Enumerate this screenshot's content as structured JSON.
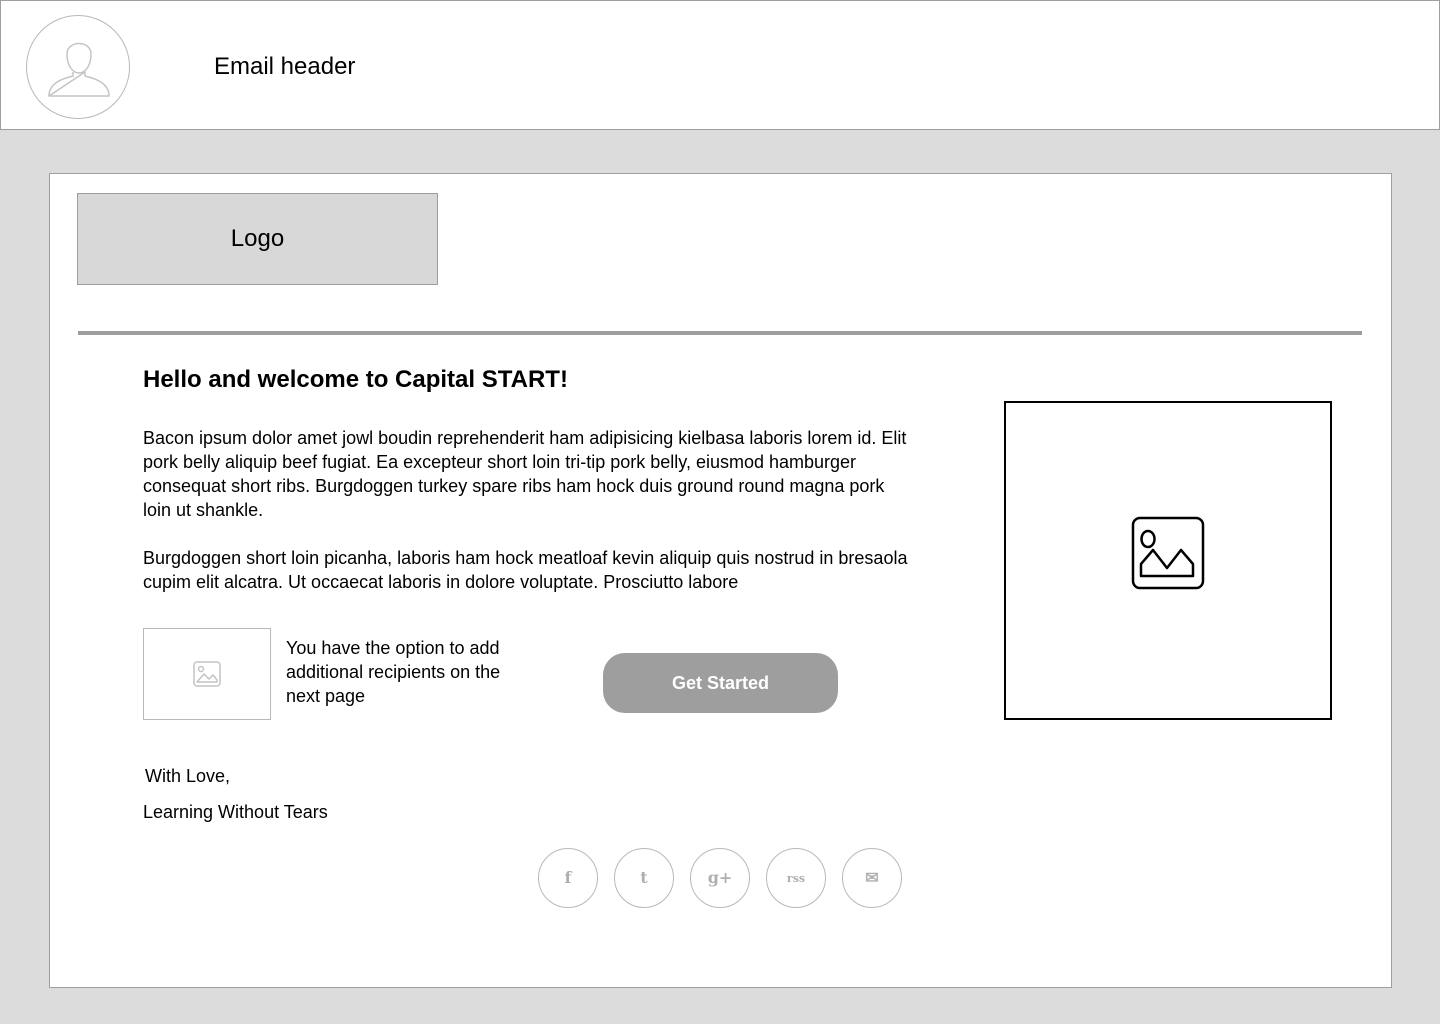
{
  "header": {
    "title": "Email header",
    "avatar_icon": "user-avatar-icon"
  },
  "email": {
    "logo_label": "Logo",
    "welcome_title": "Hello and welcome to Capital START!",
    "paragraphs": [
      "Bacon ipsum dolor amet jowl boudin reprehenderit ham adipisicing kielbasa laboris lorem id. Elit pork belly aliquip beef fugiat. Ea excepteur short loin tri-tip pork belly, eiusmod hamburger consequat short ribs. Burgdoggen turkey spare ribs ham hock duis ground round magna pork loin ut shankle.",
      "Burgdoggen short loin picanha, laboris ham hock meatloaf kevin aliquip quis nostrud in bresaola cupim elit alcatra. Ut occaecat laboris in dolore voluptate. Prosciutto labore"
    ],
    "hero_image_icon": "image-placeholder-icon",
    "thumb_image_icon": "image-placeholder-icon",
    "option_text": "You have the option to add additional recipients on the next page",
    "cta_label": "Get Started",
    "signoff": "With Love,",
    "signature": "Learning Without Tears"
  },
  "social": [
    {
      "name": "facebook",
      "icon": "facebook-icon",
      "glyph": "f"
    },
    {
      "name": "twitter",
      "icon": "twitter-icon",
      "glyph": "t"
    },
    {
      "name": "google-plus",
      "icon": "google-plus-icon",
      "glyph": "g+"
    },
    {
      "name": "rss",
      "icon": "rss-icon",
      "glyph": "rss"
    },
    {
      "name": "email",
      "icon": "envelope-icon",
      "glyph": "✉"
    }
  ],
  "colors": {
    "background": "#dcdcdc",
    "surface": "#ffffff",
    "border": "#9e9e9e",
    "logo_fill": "#d8d8d8",
    "button_fill": "#9e9e9e",
    "button_text": "#ffffff",
    "icon_gray": "#b0b0b0"
  }
}
